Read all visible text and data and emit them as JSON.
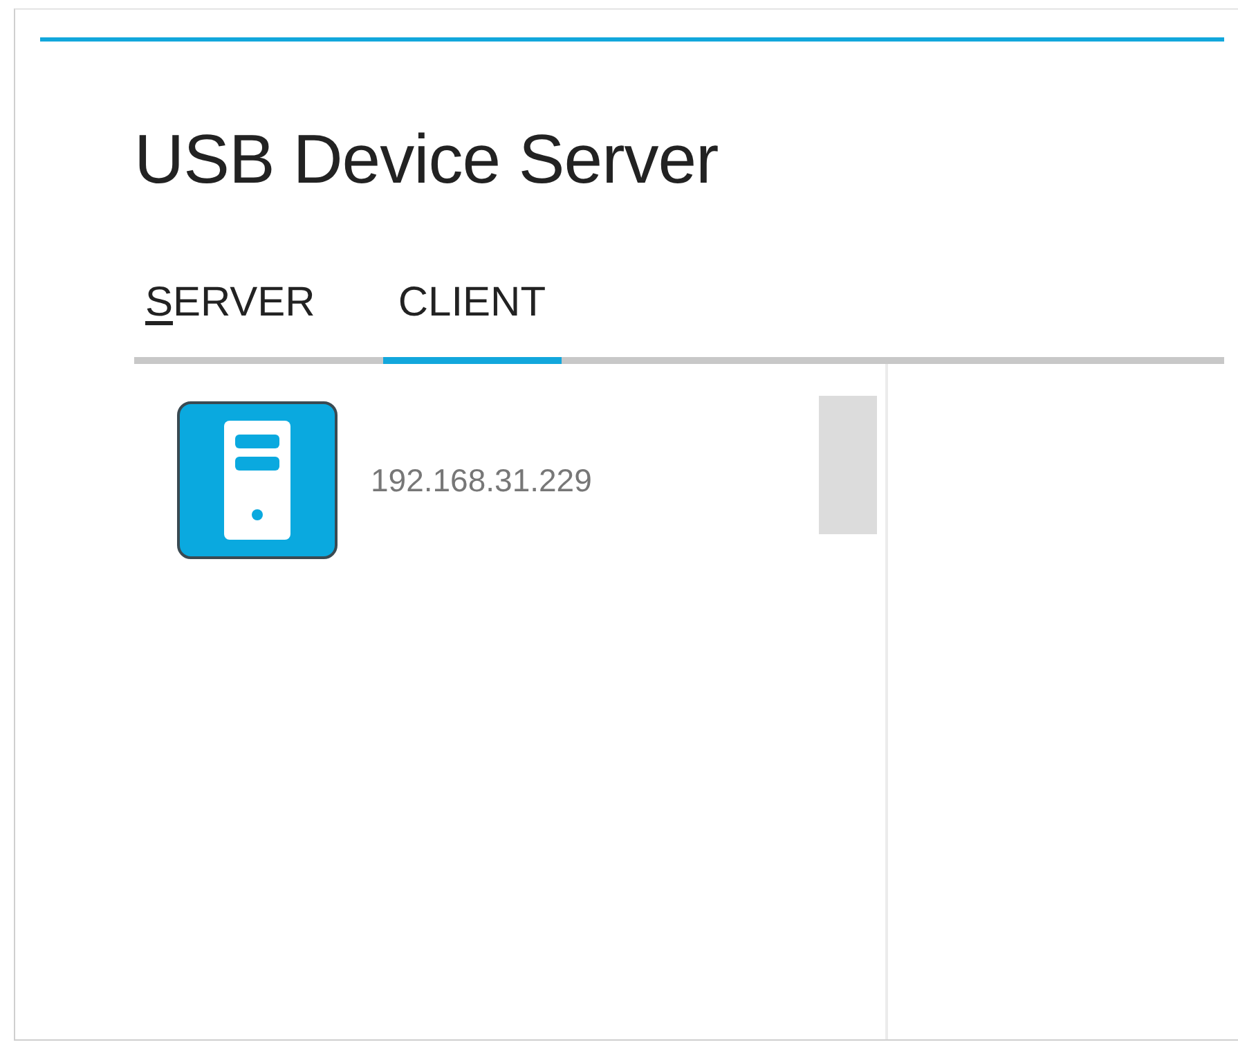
{
  "window": {
    "title": "USB Device Server"
  },
  "tabs": [
    {
      "label": "SERVER",
      "selected": false,
      "mnemonic_shown": true
    },
    {
      "label": "CLIENT",
      "selected": true,
      "mnemonic_shown": false
    }
  ],
  "servers": [
    {
      "address": "192.168.31.229"
    }
  ]
}
